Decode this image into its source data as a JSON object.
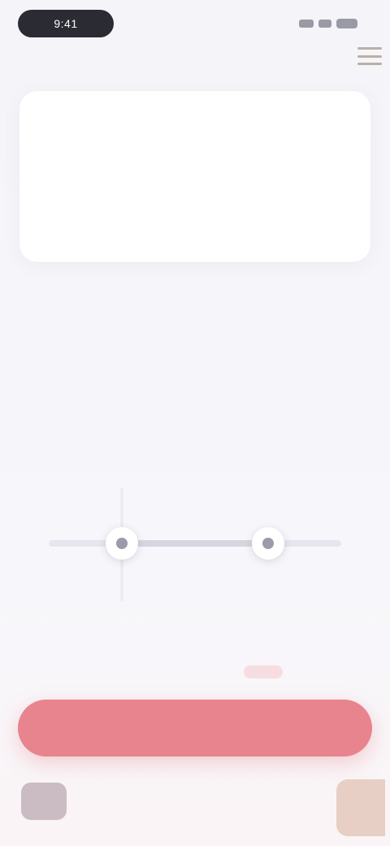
{
  "status_bar": {
    "time": "9:41"
  },
  "info_card": {
    "title": "",
    "body": ""
  },
  "prompt": {
    "text": ""
  },
  "slider": {
    "left_value": 0.25,
    "right_value": 0.75
  },
  "cta": {
    "label": ""
  },
  "colors": {
    "accent": "#e8848d",
    "background": "#f6f6fa"
  }
}
